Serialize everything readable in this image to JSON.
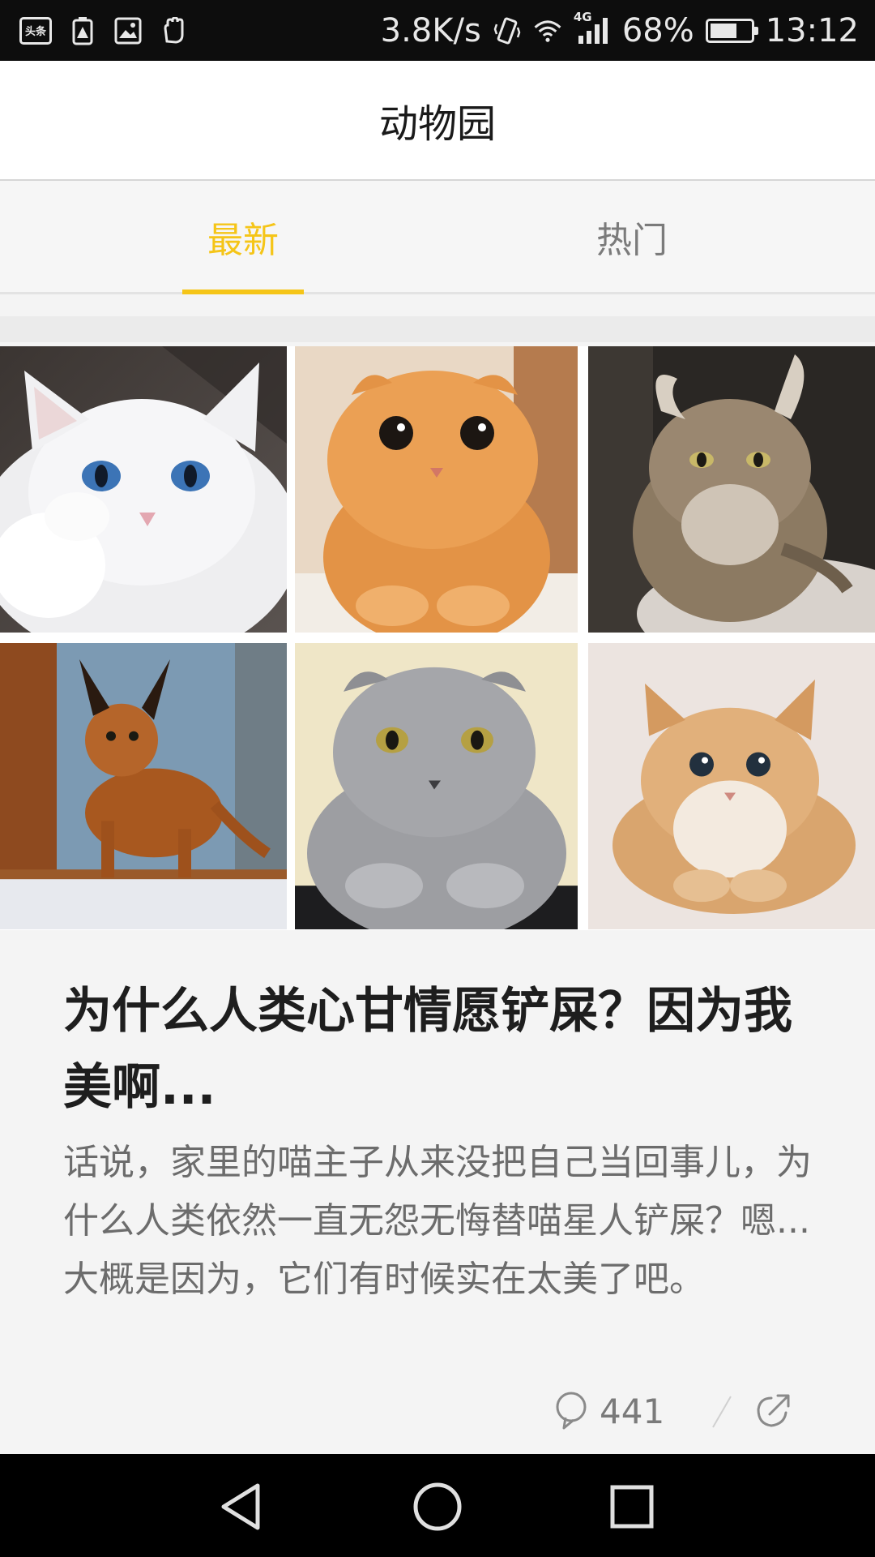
{
  "status_bar": {
    "news_badge": "头条",
    "network_speed": "3.8K/s",
    "network_type": "4G",
    "battery_percent_label": "68%",
    "battery_level": 0.68,
    "time": "13:12",
    "icons": [
      "news-app-icon",
      "battery-alert-icon",
      "image-icon",
      "hand-icon",
      "vibrate-icon",
      "wifi-icon",
      "signal-icon",
      "battery-icon"
    ]
  },
  "header": {
    "title": "动物园"
  },
  "tabs": [
    {
      "label": "最新",
      "active": true
    },
    {
      "label": "热门",
      "active": false
    }
  ],
  "colors": {
    "accent": "#f5c518",
    "text_primary": "#1e1e1e",
    "text_secondary": "#6c6c6c",
    "inactive_tab": "#7b7b7b"
  },
  "article": {
    "images": [
      {
        "name": "white-cat-blue-eyes"
      },
      {
        "name": "orange-tabby-cat"
      },
      {
        "name": "fluffy-tufted-cat"
      },
      {
        "name": "caracal-kitten"
      },
      {
        "name": "grey-scottish-fold-cat"
      },
      {
        "name": "golden-round-cat"
      }
    ],
    "title": "为什么人类心甘情愿铲屎？因为我美啊...",
    "summary": "话说，家里的喵主子从来没把自己当回事儿，为什么人类依然一直无怨无悔替喵星人铲屎？嗯...大概是因为，它们有时候实在太美了吧。",
    "comment_count": "441"
  },
  "nav_bar": {
    "buttons": [
      "back-icon",
      "home-icon",
      "recents-icon"
    ]
  }
}
